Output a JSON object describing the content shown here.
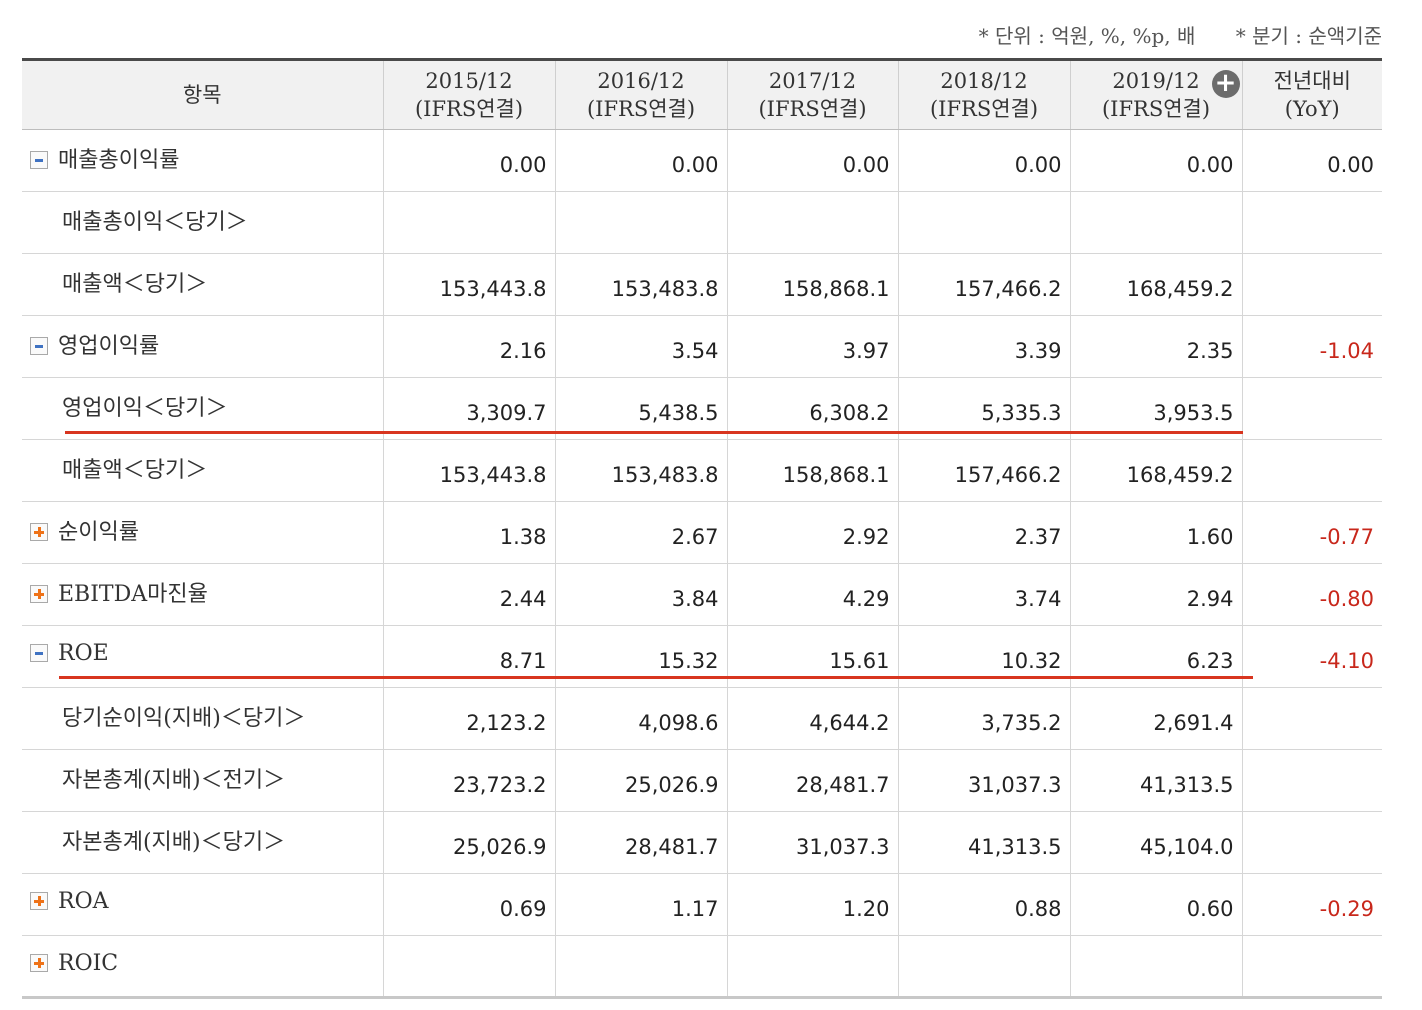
{
  "notes": {
    "unit": "* 단위 : 억원, %, %p, 배",
    "quarter": "* 분기 : 순액기준"
  },
  "header": {
    "item": "항목",
    "periods": [
      {
        "year": "2015/12",
        "basis": "(IFRS연결)"
      },
      {
        "year": "2016/12",
        "basis": "(IFRS연결)"
      },
      {
        "year": "2017/12",
        "basis": "(IFRS연결)"
      },
      {
        "year": "2018/12",
        "basis": "(IFRS연결)"
      },
      {
        "year": "2019/12",
        "basis": "(IFRS연결)"
      }
    ],
    "expand_icon": "plus-circle-icon",
    "yoy": {
      "line1": "전년대비",
      "line2": "(YoY)"
    }
  },
  "rows": [
    {
      "label": "매출총이익률",
      "toggle": "minus",
      "values": [
        "0.00",
        "0.00",
        "0.00",
        "0.00",
        "0.00"
      ],
      "yoy": "0.00"
    },
    {
      "label": "매출총이익＜당기＞",
      "toggle": "",
      "values": [
        "",
        "",
        "",
        "",
        ""
      ],
      "yoy": ""
    },
    {
      "label": "매출액＜당기＞",
      "toggle": "",
      "values": [
        "153,443.8",
        "153,483.8",
        "158,868.1",
        "157,466.2",
        "168,459.2"
      ],
      "yoy": ""
    },
    {
      "label": "영업이익률",
      "toggle": "minus",
      "values": [
        "2.16",
        "3.54",
        "3.97",
        "3.39",
        "2.35"
      ],
      "yoy": "-1.04"
    },
    {
      "label": "영업이익＜당기＞",
      "toggle": "",
      "values": [
        "3,309.7",
        "5,438.5",
        "6,308.2",
        "5,335.3",
        "3,953.5"
      ],
      "yoy": ""
    },
    {
      "label": "매출액＜당기＞",
      "toggle": "",
      "values": [
        "153,443.8",
        "153,483.8",
        "158,868.1",
        "157,466.2",
        "168,459.2"
      ],
      "yoy": ""
    },
    {
      "label": "순이익률",
      "toggle": "plus",
      "values": [
        "1.38",
        "2.67",
        "2.92",
        "2.37",
        "1.60"
      ],
      "yoy": "-0.77"
    },
    {
      "label": "EBITDA마진율",
      "toggle": "plus",
      "values": [
        "2.44",
        "3.84",
        "4.29",
        "3.74",
        "2.94"
      ],
      "yoy": "-0.80"
    },
    {
      "label": "ROE",
      "toggle": "minus",
      "values": [
        "8.71",
        "15.32",
        "15.61",
        "10.32",
        "6.23"
      ],
      "yoy": "-4.10"
    },
    {
      "label": "당기순이익(지배)＜당기＞",
      "toggle": "",
      "values": [
        "2,123.2",
        "4,098.6",
        "4,644.2",
        "3,735.2",
        "2,691.4"
      ],
      "yoy": ""
    },
    {
      "label": "자본총계(지배)＜전기＞",
      "toggle": "",
      "values": [
        "23,723.2",
        "25,026.9",
        "28,481.7",
        "31,037.3",
        "41,313.5"
      ],
      "yoy": ""
    },
    {
      "label": "자본총계(지배)＜당기＞",
      "toggle": "",
      "values": [
        "25,026.9",
        "28,481.7",
        "31,037.3",
        "41,313.5",
        "45,104.0"
      ],
      "yoy": ""
    },
    {
      "label": "ROA",
      "toggle": "plus",
      "values": [
        "0.69",
        "1.17",
        "1.20",
        "0.88",
        "0.60"
      ],
      "yoy": "-0.29"
    },
    {
      "label": "ROIC",
      "toggle": "plus",
      "values": [
        "",
        "",
        "",
        "",
        ""
      ],
      "yoy": ""
    }
  ],
  "colors": {
    "negative": "#c8271b",
    "annotation_underline": "#d8351f",
    "minus_toggle": "#3f72c2",
    "plus_toggle": "#ee7218"
  }
}
